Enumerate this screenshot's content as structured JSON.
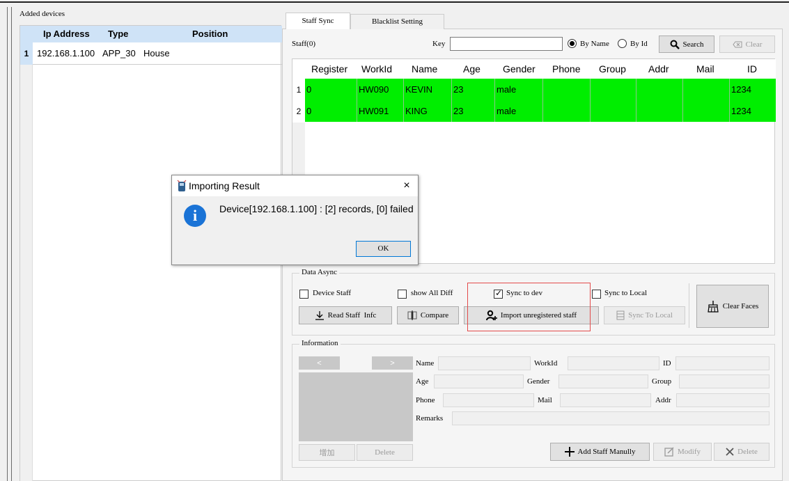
{
  "devices": {
    "title": "Added devices",
    "columns": [
      "Ip Address",
      "Type",
      "Position"
    ],
    "rows": [
      {
        "num": "1",
        "ip": "192.168.1.100",
        "type": "APP_30",
        "position": "House"
      }
    ]
  },
  "tabs": [
    "Staff Sync",
    "Blacklist Setting"
  ],
  "search": {
    "staff_count": "Staff(0)",
    "key_label": "Key",
    "key_value": "",
    "by_name": "By Name",
    "by_id": "By Id",
    "search_btn": "Search",
    "clear_btn": "Clear"
  },
  "staff_table": {
    "columns": [
      "Register",
      "WorkId",
      "Name",
      "Age",
      "Gender",
      "Phone",
      "Group",
      "Addr",
      "Mail",
      "ID"
    ],
    "rows": [
      {
        "num": "1",
        "register": "0",
        "workid": "HW090",
        "name": "KEVIN",
        "age": "23",
        "gender": "male",
        "phone": "",
        "group": "",
        "addr": "",
        "mail": "",
        "id": "1234"
      },
      {
        "num": "2",
        "register": "0",
        "workid": "HW091",
        "name": "KING",
        "age": "23",
        "gender": "male",
        "phone": "",
        "group": "",
        "addr": "",
        "mail": "",
        "id": "1234"
      }
    ],
    "row_color": "#00ee00"
  },
  "data_async": {
    "title": "Data Async",
    "device_staff": "Device Staff",
    "show_all_diff": "show All Diff",
    "sync_to_dev": "Sync to dev",
    "sync_to_local": "Sync to Local",
    "read_btn": "Read Staff  Infc",
    "compare_btn": "Compare",
    "import_btn": "Import unregistered staff",
    "sync_local_btn": "Sync To Local",
    "clear_faces_btn": "Clear Faces"
  },
  "information": {
    "title": "Information",
    "prev": "<",
    "next": ">",
    "add_btn": "增加",
    "photo_delete_btn": "Delete",
    "labels": {
      "name": "Name",
      "workid": "WorkId",
      "id": "ID",
      "age": "Age",
      "gender": "Gender",
      "group": "Group",
      "phone": "Phone",
      "mail": "Mail",
      "addr": "Addr",
      "remarks": "Remarks"
    },
    "add_staff_btn": "Add Staff Manully",
    "modify_btn": "Modify",
    "delete_btn": "Delete"
  },
  "dialog": {
    "title": "Importing Result",
    "message": "Device[192.168.1.100] : [2] records, [0] failed",
    "ok": "OK",
    "close": "×"
  },
  "colors": {
    "header_blue": "#cfe3f7",
    "highlight_red": "#e34a4a",
    "info_blue": "#1a73d6"
  }
}
